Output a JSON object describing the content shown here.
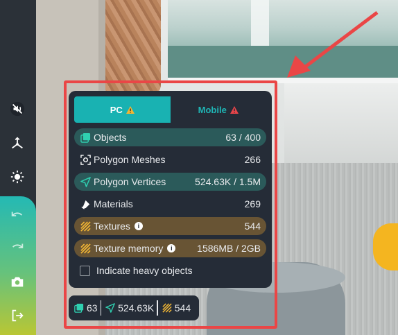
{
  "toolbar": {
    "items": [
      {
        "name": "mute-icon"
      },
      {
        "name": "axes-icon"
      },
      {
        "name": "brightness-icon"
      },
      {
        "name": "undo-icon"
      },
      {
        "name": "redo-icon"
      },
      {
        "name": "camera-icon"
      },
      {
        "name": "exit-icon"
      }
    ]
  },
  "panel": {
    "tabs": [
      {
        "label": "PC",
        "status": "warning",
        "active": true
      },
      {
        "label": "Mobile",
        "status": "error",
        "active": false
      }
    ],
    "stats": [
      {
        "icon": "image-stack-icon",
        "label": "Objects",
        "value": "63 / 400",
        "state": "ok"
      },
      {
        "icon": "polygon-mesh-icon",
        "label": "Polygon Meshes",
        "value": "266",
        "state": "neutral"
      },
      {
        "icon": "vertex-arrow-icon",
        "label": "Polygon Vertices",
        "value": "524.63K / 1.5M",
        "state": "ok"
      },
      {
        "icon": "material-icon",
        "label": "Materials",
        "value": "269",
        "state": "neutral"
      },
      {
        "icon": "texture-icon",
        "label": "Textures",
        "value": "544",
        "state": "warning",
        "info": true
      },
      {
        "icon": "texture-icon",
        "label": "Texture memory",
        "value": "1586MB / 2GB",
        "state": "warning",
        "info": true
      }
    ],
    "heavy_objects_label": "Indicate heavy objects",
    "heavy_objects_checked": false
  },
  "summary": {
    "objects": "63",
    "vertices": "524.63K",
    "textures": "544"
  },
  "colors": {
    "accent": "#19b2b2",
    "ok_row": "#2b5a5a",
    "warning_row": "#685434",
    "panel_bg": "#252c37",
    "annotation": "#ea4646",
    "warning": "#f2b634",
    "error": "#e8454a"
  }
}
